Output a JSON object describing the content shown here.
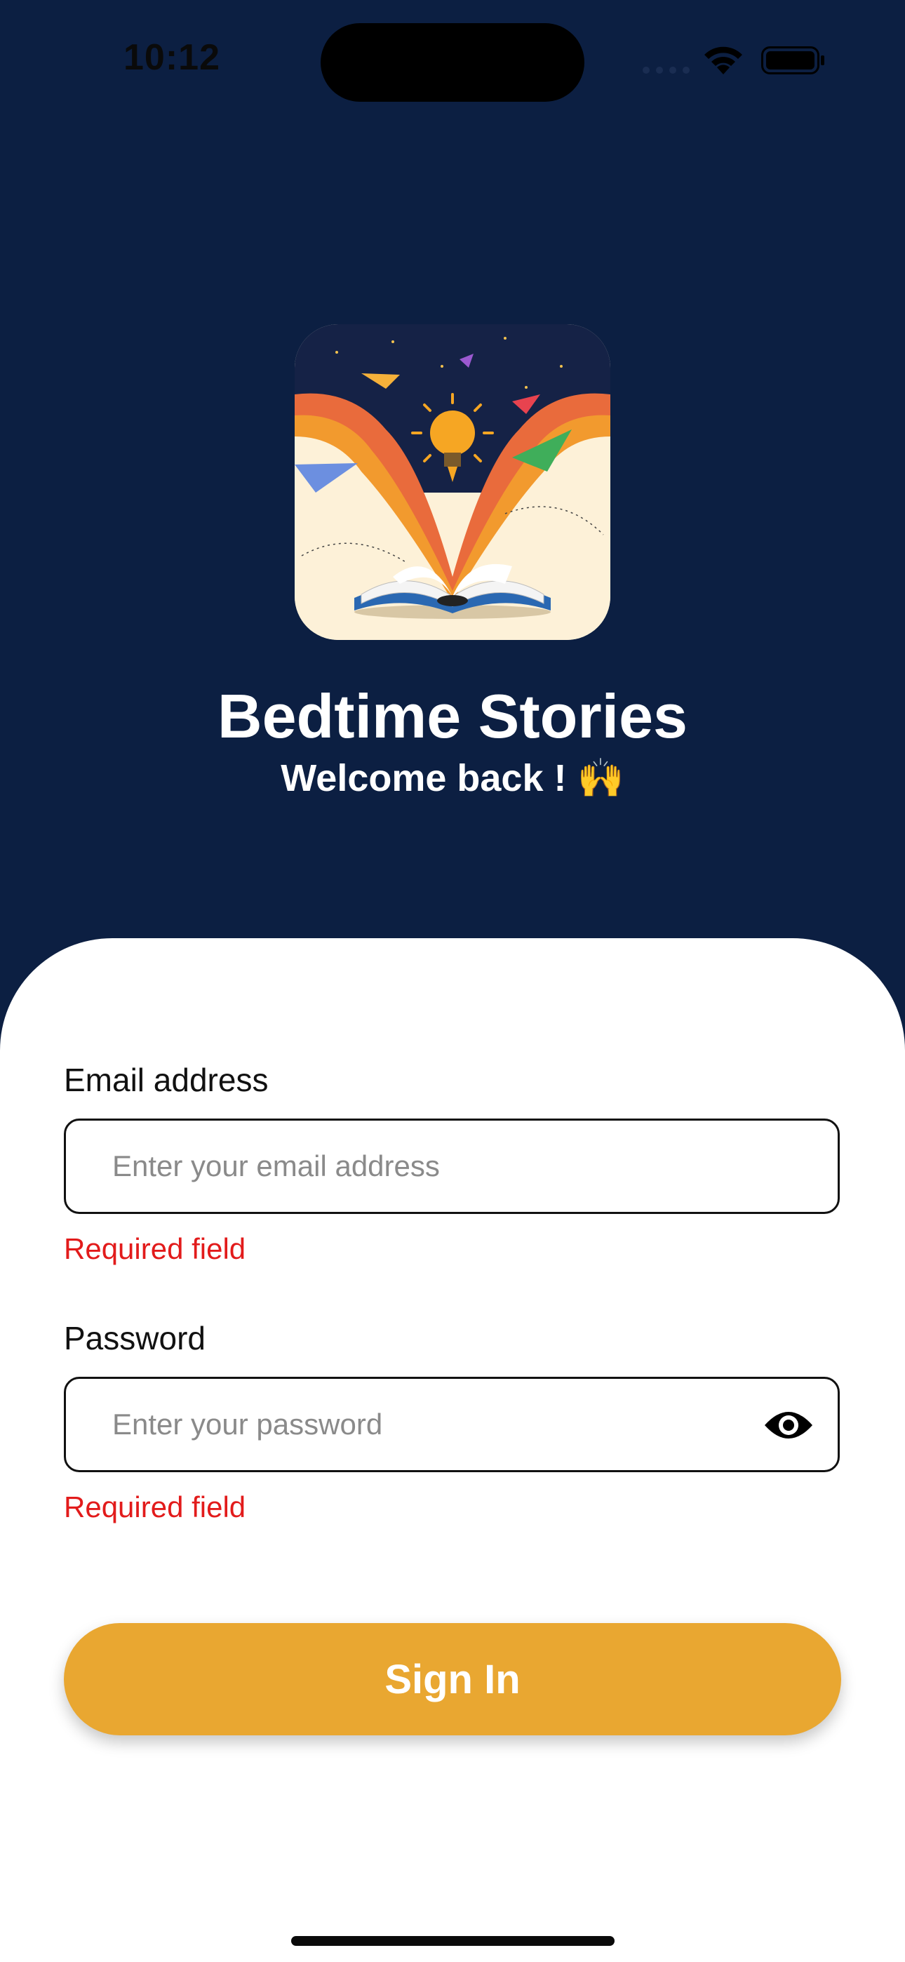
{
  "status_bar": {
    "time": "10:12",
    "icons": [
      "signal-icon",
      "wifi-icon",
      "battery-icon"
    ]
  },
  "header": {
    "logo": "bedtime-stories-logo",
    "title": "Bedtime Stories",
    "subtitle": "Welcome back ! 🙌"
  },
  "form": {
    "email": {
      "label": "Email address",
      "placeholder": "Enter your email address",
      "value": "",
      "error": "Required field"
    },
    "password": {
      "label": "Password",
      "placeholder": "Enter your password",
      "value": "",
      "error": "Required field",
      "toggle_icon": "eye-icon"
    },
    "submit_label": "Sign In"
  },
  "colors": {
    "background": "#0c1f42",
    "sheet": "#ffffff",
    "accent": "#e9a731",
    "error": "#e21b1b"
  }
}
